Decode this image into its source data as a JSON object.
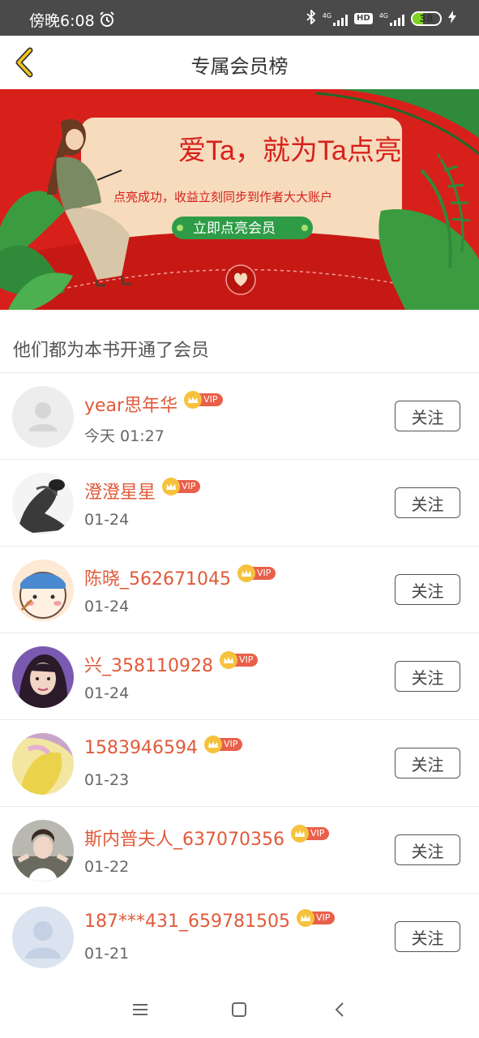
{
  "status_bar": {
    "time": "傍晚6:08",
    "net1": "4G",
    "net2": "4G",
    "hd": "HD",
    "battery_pct": "38",
    "battery_level": 0.38,
    "icons": [
      "alarm-clock-icon",
      "bluetooth-icon",
      "signal-icon",
      "signal-icon",
      "charging-bolt-icon"
    ]
  },
  "header": {
    "title": "专属会员榜",
    "back_icon": "chevron-left-icon"
  },
  "banner": {
    "headline": "爱Ta，就为Ta点亮会员",
    "subtitle": "点亮成功，收益立刻同步到作者大大账户",
    "cta": "立即点亮会员",
    "colors": {
      "red": "#d8201b",
      "card": "#f5d9b8",
      "leaf": "#3a8f3c",
      "cta": "#2e9c47"
    }
  },
  "section": {
    "title": "他们都为本书开通了会员"
  },
  "members": [
    {
      "name": "year思年华",
      "date": "今天 01:27",
      "vip": "VIP",
      "follow": "关注",
      "avatar": "default"
    },
    {
      "name": "澄澄星星",
      "date": "01-24",
      "vip": "VIP",
      "follow": "关注",
      "avatar": "sketch"
    },
    {
      "name": "陈晓_562671045",
      "date": "01-24",
      "vip": "VIP",
      "follow": "关注",
      "avatar": "cartoon"
    },
    {
      "name": "兴_358110928",
      "date": "01-24",
      "vip": "VIP",
      "follow": "关注",
      "avatar": "photo-girl"
    },
    {
      "name": "1583946594",
      "date": "01-23",
      "vip": "VIP",
      "follow": "关注",
      "avatar": "yellow"
    },
    {
      "name": "斯内普夫人_637070356",
      "date": "01-22",
      "vip": "VIP",
      "follow": "关注",
      "avatar": "photo-group"
    },
    {
      "name": "187***431_659781505",
      "date": "01-21",
      "vip": "VIP",
      "follow": "关注",
      "avatar": "default-blue"
    }
  ],
  "navbar": {
    "icons": [
      "menu-icon",
      "home-square-icon",
      "back-triangle-icon"
    ]
  }
}
